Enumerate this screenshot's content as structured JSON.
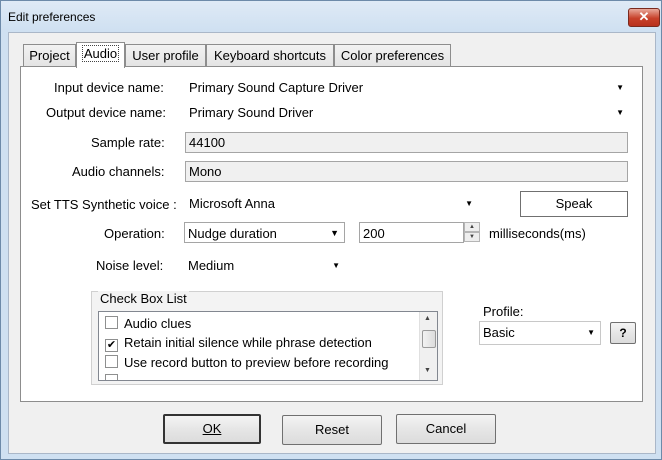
{
  "window": {
    "title": "Edit preferences",
    "close_glyph": "✕"
  },
  "tabs": [
    {
      "label": "Project"
    },
    {
      "label": "Audio",
      "active": true
    },
    {
      "label": "User profile"
    },
    {
      "label": "Keyboard shortcuts"
    },
    {
      "label": "Color preferences"
    }
  ],
  "audio": {
    "input_device_label": "Input device name:",
    "input_device_value": "Primary Sound Capture Driver",
    "output_device_label": "Output device name:",
    "output_device_value": "Primary Sound Driver",
    "sample_rate_label": "Sample rate:",
    "sample_rate_value": "44100",
    "channels_label": "Audio channels:",
    "channels_value": "Mono",
    "tts_label": "Set TTS Synthetic voice :",
    "tts_value": "Microsoft Anna",
    "speak_label": "Speak",
    "operation_label": "Operation:",
    "operation_value": "Nudge duration",
    "operation_amount": "200",
    "operation_unit": "milliseconds(ms)",
    "noise_label": "Noise level:",
    "noise_value": "Medium"
  },
  "checkbox_list": {
    "title": "Check Box List",
    "items": [
      {
        "label": "Audio clues",
        "checked": false
      },
      {
        "label": "Retain initial silence while phrase detection",
        "checked": true
      },
      {
        "label": "Use record button to preview before recording",
        "checked": false
      }
    ]
  },
  "profile": {
    "label": "Profile:",
    "value": "Basic",
    "help_label": "?"
  },
  "buttons": {
    "ok": "OK",
    "reset": "Reset",
    "cancel": "Cancel"
  },
  "icons": {
    "dropdown": "chevron-down-icon",
    "close": "close-icon",
    "check": "checkmark-icon"
  }
}
